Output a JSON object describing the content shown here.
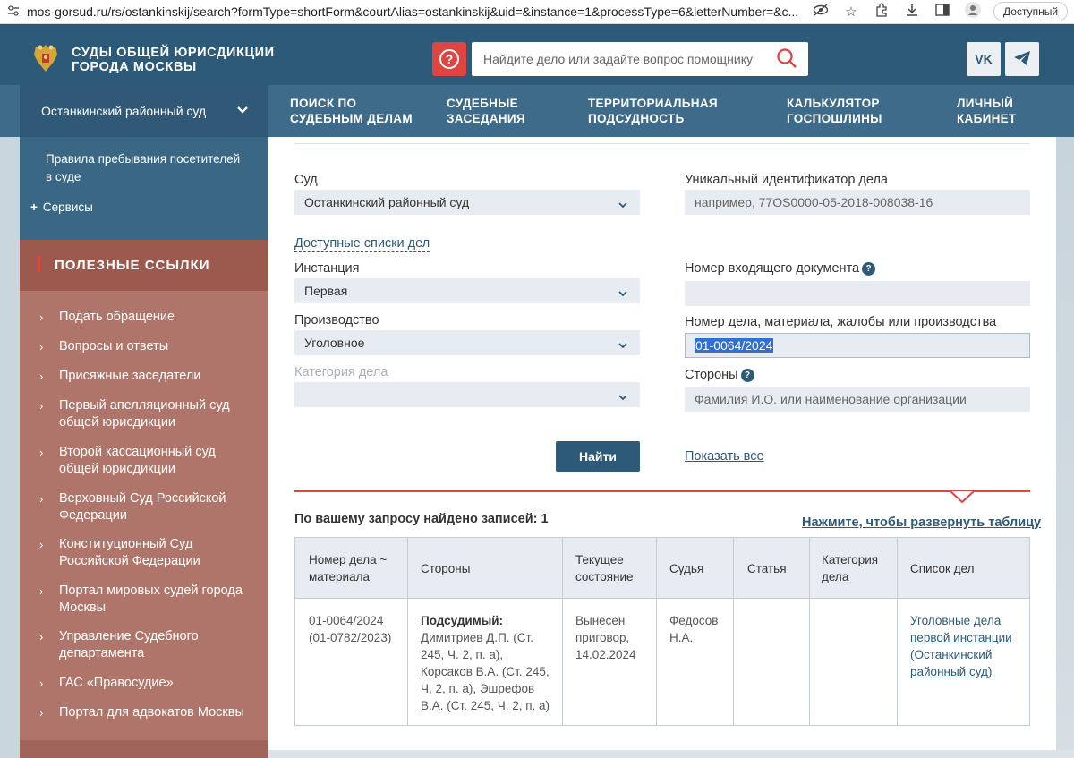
{
  "browser": {
    "url": "mos-gorsud.ru/rs/ostankinskij/search?formType=shortForm&courtAlias=ostankinskij&uid=&instance=1&processType=6&letterNumber=&c...",
    "access_label": "Доступный"
  },
  "header": {
    "brand_line1": "СУДЫ ОБЩЕЙ ЮРИСДИКЦИИ",
    "brand_line2": "ГОРОДА МОСКВЫ",
    "help_glyph": "?",
    "search_placeholder": "Найдите дело или задайте вопрос помощнику",
    "vk_label": "VK"
  },
  "nav": {
    "court_select": "Останкинский районный суд",
    "items": [
      {
        "line1": "ПОИСК ПО",
        "line2": "СУДЕБНЫМ ДЕЛАМ"
      },
      {
        "line1": "СУДЕБНЫЕ",
        "line2": "ЗАСЕДАНИЯ"
      },
      {
        "line1": "ТЕРРИТОРИАЛЬНАЯ",
        "line2": "ПОДСУДНОСТЬ"
      },
      {
        "line1": "КАЛЬКУЛЯТОР",
        "line2": "ГОСПОШЛИНЫ"
      },
      {
        "line1": "ЛИЧНЫЙ",
        "line2": "КАБИНЕТ"
      }
    ]
  },
  "sidebar": {
    "rules_line1": "Правила пребывания посетителей",
    "rules_line2": "в суде",
    "services": "Сервисы",
    "useful_title": "ПОЛЕЗНЫЕ ССЫЛКИ",
    "links": [
      {
        "l1": "Подать обращение",
        "l2": ""
      },
      {
        "l1": "Вопросы и ответы",
        "l2": ""
      },
      {
        "l1": "Присяжные заседатели",
        "l2": ""
      },
      {
        "l1": "Первый апелляционный суд",
        "l2": "общей юрисдикции"
      },
      {
        "l1": "Второй кассационный суд",
        "l2": "общей юрисдикции"
      },
      {
        "l1": "Верховный Суд Российской",
        "l2": "Федерации"
      },
      {
        "l1": "Конституционный Суд",
        "l2": "Российской Федерации"
      },
      {
        "l1": "Портал мировых судей города",
        "l2": "Москвы"
      },
      {
        "l1": "Управление Судебного",
        "l2": "департамента"
      },
      {
        "l1": "ГАС «Правосудие»",
        "l2": ""
      },
      {
        "l1": "Портал для адвокатов Москвы",
        "l2": ""
      }
    ]
  },
  "form": {
    "court_label": "Суд",
    "court_value": "Останкинский районный суд",
    "uid_label": "Уникальный идентификатор дела",
    "uid_placeholder": "например, 77OS0000-05-2018-008038-16",
    "available_lists": "Доступные списки дел",
    "instance_label": "Инстанция",
    "instance_value": "Первая",
    "incoming_label": "Номер входящего документа",
    "proceeding_label": "Производство",
    "proceeding_value": "Уголовное",
    "case_number_label": "Номер дела, материала, жалобы или производства",
    "case_number_value": "01-0064/2024",
    "category_label": "Категория дела",
    "parties_label": "Стороны",
    "parties_placeholder": "Фамилия И.О. или наименование организации",
    "find_button": "Найти",
    "show_all": "Показать все"
  },
  "results": {
    "found_text": "По вашему запросу найдено записей: 1",
    "expand_link": "Нажмите, чтобы развернуть таблицу",
    "columns": {
      "number_l1": "Номер дела ~",
      "number_l2": "материала",
      "parties": "Стороны",
      "state_l1": "Текущее",
      "state_l2": "состояние",
      "judge": "Судья",
      "article": "Статья",
      "category_l1": "Категория",
      "category_l2": "дела",
      "list": "Список дел"
    },
    "row": {
      "case_number": "01-0064/2024",
      "material_number": "(01-0782/2023)",
      "parties_role": "Подсудимый:",
      "party1_name": "Димитриев Д.П.",
      "party1_rest": " (Ст.",
      "party1_line2": "245, Ч. 2, п. а),",
      "party2_name": "Корсаков В.А.",
      "party2_rest": " (Ст. 245,",
      "party2_line2a": "Ч. 2, п. а), ",
      "party3_name": "Эшрефов",
      "party3_name2": "В.А.",
      "party3_rest": " (Ст. 245, Ч. 2, п. а)",
      "state_l1": "Вынесен",
      "state_l2": "приговор,",
      "state_l3": "14.02.2024",
      "judge_l1": "Федосов",
      "judge_l2": "Н.А.",
      "list_l1": "Уголовные дела",
      "list_l2": "первой инстанции",
      "list_l3": "(Останкинский",
      "list_l4": "районный суд)"
    }
  },
  "colors": {
    "header_bg": "#2d5a78",
    "nav_bg": "#3d6b89",
    "accent_red": "#e04440",
    "links_bg": "#b0756a",
    "field_bg": "#e6ecf1"
  }
}
